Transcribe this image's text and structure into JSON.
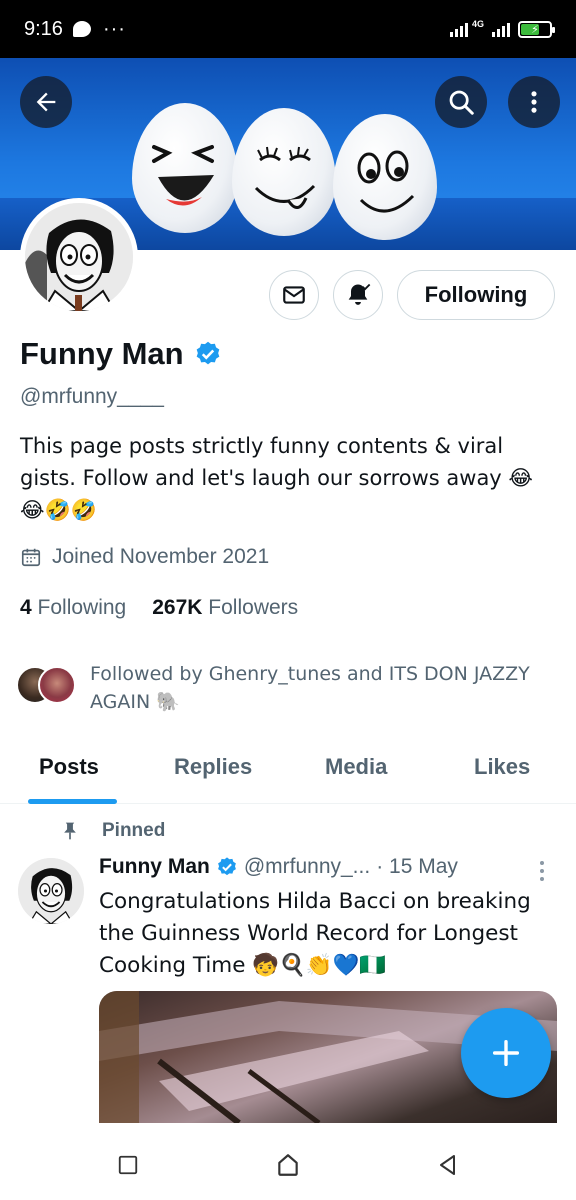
{
  "status_bar": {
    "time": "9:16",
    "dots": "···",
    "network": "4G"
  },
  "profile": {
    "name": "Funny Man",
    "handle": "@mrfunny____",
    "bio": "This page posts strictly funny contents & viral gists. Follow and let's laugh our sorrows away 😂😂🤣🤣",
    "joined": "Joined November 2021",
    "following_count": "4",
    "following_label": "Following",
    "followers_count": "267K",
    "followers_label": "Followers",
    "followed_by": "Followed by Ghenry_tunes and ITS DON JAZZY AGAIN 🐘",
    "follow_button_label": "Following"
  },
  "tabs": [
    {
      "label": "Posts",
      "active": true
    },
    {
      "label": "Replies",
      "active": false
    },
    {
      "label": "Media",
      "active": false
    },
    {
      "label": "Likes",
      "active": false
    }
  ],
  "post": {
    "pinned_label": "Pinned",
    "author": "Funny Man",
    "handle": "@mrfunny_...",
    "date": "· 15 May",
    "text": "Congratulations Hilda Bacci on breaking the Guinness World Record for Longest Cooking Time 🧒🍳👏💙🇳🇬"
  },
  "colors": {
    "accent": "#1d9bf0",
    "text": "#0f1419",
    "secondary_text": "#536471",
    "verified": "#1d9bf0"
  },
  "icons": {
    "back": "arrow-left-icon",
    "search": "search-icon",
    "more": "more-vertical-icon",
    "message": "mail-icon",
    "notifications": "bell-check-icon",
    "verified": "verified-badge-icon",
    "calendar": "calendar-icon",
    "pin": "pin-icon",
    "compose": "plus-icon"
  }
}
